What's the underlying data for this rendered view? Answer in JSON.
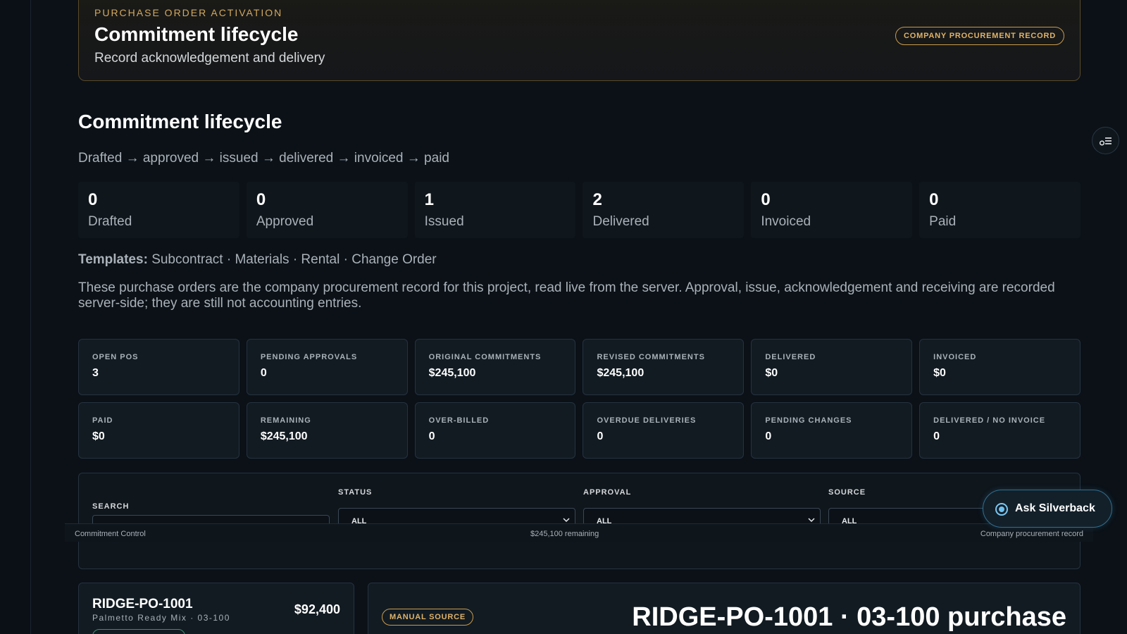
{
  "hero": {
    "eyebrow": "PURCHASE ORDER ACTIVATION",
    "title": "Commitment lifecycle",
    "subtitle": "Record acknowledgement and delivery",
    "badge": "COMPANY PROCUREMENT RECORD"
  },
  "section": {
    "title": "Commitment lifecycle",
    "flow": "Drafted → approved → issued → delivered → invoiced → paid"
  },
  "stages": [
    {
      "count": "0",
      "label": "Drafted"
    },
    {
      "count": "0",
      "label": "Approved"
    },
    {
      "count": "1",
      "label": "Issued"
    },
    {
      "count": "2",
      "label": "Delivered"
    },
    {
      "count": "0",
      "label": "Invoiced"
    },
    {
      "count": "0",
      "label": "Paid"
    }
  ],
  "templates": {
    "label": "Templates:",
    "items": "Subcontract · Materials · Rental · Change Order"
  },
  "description": "These purchase orders are the company procurement record for this project, read live from the server. Approval, issue, acknowledgement and receiving are recorded server-side; they are still not accounting entries.",
  "metrics": [
    {
      "label": "OPEN POS",
      "value": "3"
    },
    {
      "label": "PENDING APPROVALS",
      "value": "0"
    },
    {
      "label": "ORIGINAL COMMITMENTS",
      "value": "$245,100"
    },
    {
      "label": "REVISED COMMITMENTS",
      "value": "$245,100"
    },
    {
      "label": "DELIVERED",
      "value": "$0"
    },
    {
      "label": "INVOICED",
      "value": "$0"
    },
    {
      "label": "PAID",
      "value": "$0"
    },
    {
      "label": "REMAINING",
      "value": "$245,100"
    },
    {
      "label": "OVER-BILLED",
      "value": "0"
    },
    {
      "label": "OVERDUE DELIVERIES",
      "value": "0"
    },
    {
      "label": "PENDING CHANGES",
      "value": "0"
    },
    {
      "label": "DELIVERED / NO INVOICE",
      "value": "0"
    }
  ],
  "filters": {
    "search_label": "SEARCH",
    "status_label": "STATUS",
    "status_value": "ALL",
    "approval_label": "APPROVAL",
    "approval_value": "ALL",
    "source_label": "SOURCE",
    "source_value": "ALL"
  },
  "status_bar": {
    "left": "Commitment Control",
    "middle": "$245,100 remaining",
    "right": "Company procurement record"
  },
  "assistant": {
    "label": "Ask Silverback"
  },
  "po_card": {
    "id": "RIDGE-PO-1001",
    "subtitle": "Palmetto Ready Mix · 03-100",
    "amount": "$92,400"
  },
  "detail": {
    "badge": "MANUAL SOURCE",
    "title": "RIDGE-PO-1001 · 03-100 purchase"
  },
  "colors": {
    "accent_gold": "#d3a85f",
    "assistant_blue": "#6ec1ee",
    "background": "#0b1117"
  },
  "icons": {
    "assistant": "record-dot-icon",
    "side_panel": "filter-list-icon",
    "dropdown": "chevron-down-icon"
  }
}
